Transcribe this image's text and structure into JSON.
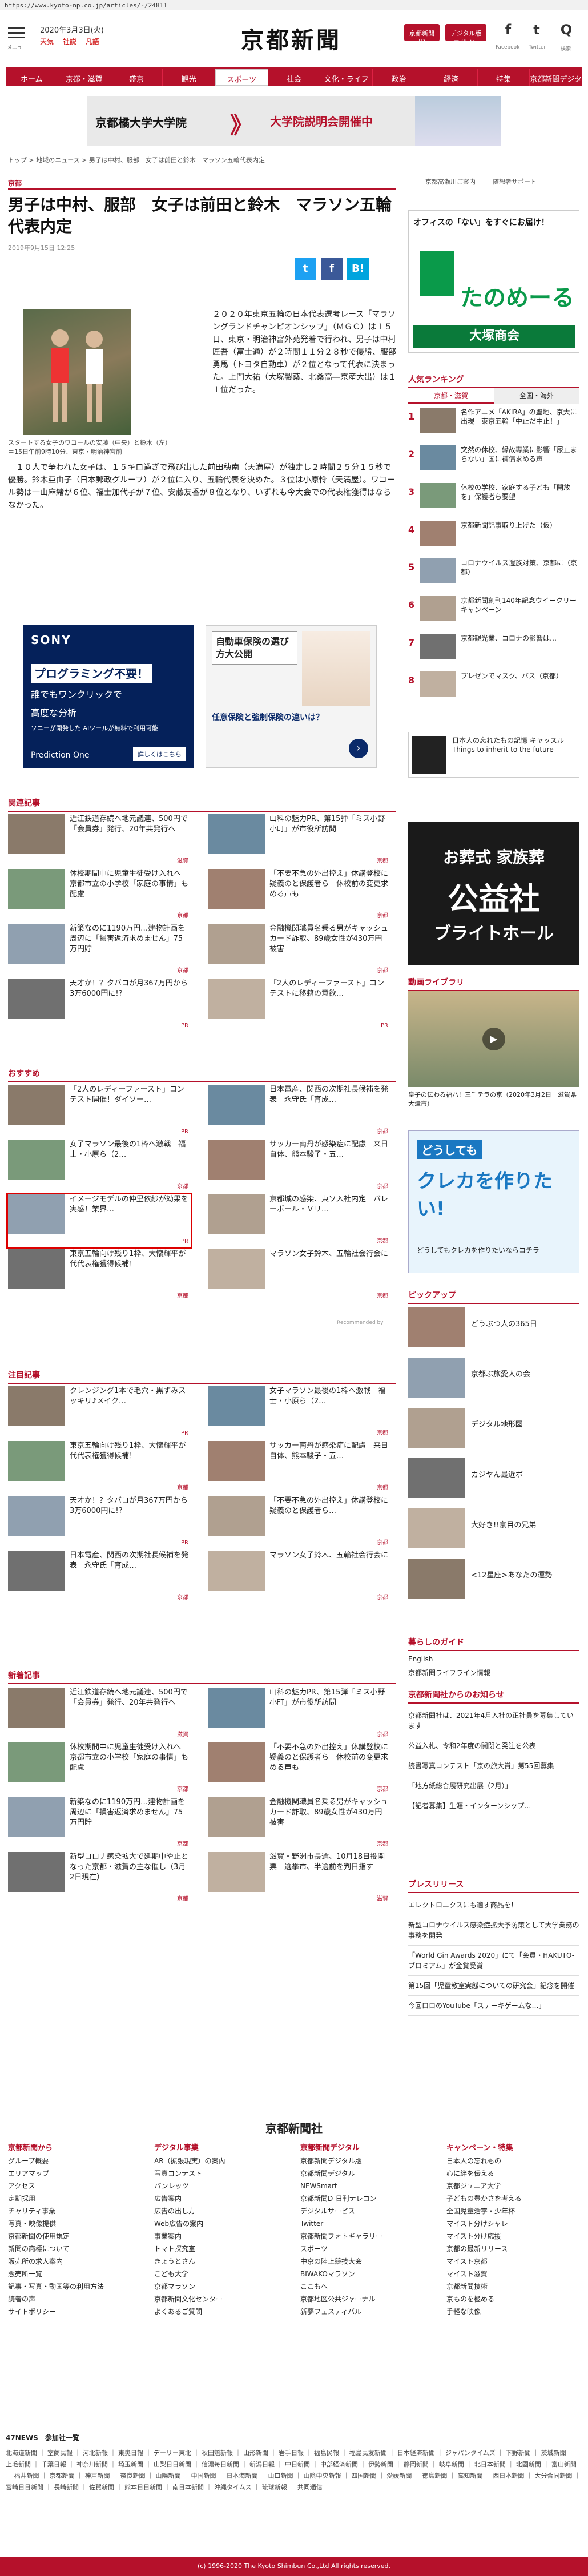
{
  "url": "https://www.kyoto-np.co.jp/articles/-/24811",
  "header": {
    "menu_label": "メニュー",
    "logo": "京都新聞",
    "date": "2020年3月3日(火)",
    "weather": [
      "天気",
      "社説",
      "凡語"
    ],
    "btn_register": "京都新聞ID",
    "btn_digital": "デジタル版ログイン",
    "social": [
      "f",
      "t",
      "Q"
    ],
    "social_labels": [
      "Facebook",
      "Twitter",
      "検索"
    ]
  },
  "nav": [
    "ホーム",
    "京都・滋賀",
    "盛京",
    "観光",
    "スポーツ",
    "社会",
    "文化・ライフ",
    "政治",
    "経済",
    "特集",
    "京都新聞デジタル"
  ],
  "nav_active": 4,
  "banner_top": {
    "text1": "京都橘大学大学院",
    "text2": "》",
    "text3": "大学院説明会開催中"
  },
  "breadcrumb": "トップ > 地域のニュース > 男子は中村、服部　女子は前田と鈴木　マラソン五輪代表内定",
  "breadcrumb_right": [
    "京都高瀬川ご案内",
    "随想者サポート"
  ],
  "article": {
    "section": "京都",
    "title": "男子は中村、服部　女子は前田と鈴木　マラソン五輪代表内定",
    "published": "2019年9月15日 12:25",
    "photo_caption": "スタートする女子のワコールの安藤（中央）と鈴木（左）＝15日午前9時10分、東京・明治神宮前",
    "p1": "２０２０年東京五輪の日本代表選考レース「マラソングランドチャンピオンシップ」（ＭＧＣ）は１５日、東京・明治神宮外苑発着で行われ、男子は中村匠吾（富士通）が２時間１１分２８秒で優勝、服部勇馬（トヨタ自動車）が２位となって代表に決まった。上門大祐（大塚製薬、北桑高―京産大出）は１１位だった。",
    "p2": "１０人で争われた女子は、１５キロ過ぎで飛び出した前田穂南（天満屋）が独走し２時間２５分１５秒で優勝。鈴木亜由子（日本郵政グループ）が２位に入り、五輪代表を決めた。３位は小原怜（天満屋）。ワコール勢は一山麻緒が６位、福士加代子が７位、安藤友香が８位となり、いずれも今大会での代表権獲得はならなかった。"
  },
  "ads_article": {
    "sony_brand": "SONY",
    "sony_line1": "プログラミング不要！",
    "sony_line2": "誰でもワンクリックで",
    "sony_line3": "高度な分析",
    "sony_line4": "ソニーが開発した AIツールが無料で利用可能",
    "sony_bottom": "Prediction One",
    "sony_cta": "詳しくはこちら",
    "ins_title": "自動車保険の選び方大公開",
    "ins_text": "任意保険と強制保険の違いは？"
  },
  "related": {
    "title": "関連記事",
    "items": [
      {
        "text": "近江鉄道存続へ地元議連、500円で「会員券」発行、20年共発行へ",
        "tag": "滋賀"
      },
      {
        "text": "山科の魅力PR、第15弾「ミス小野小町」が市役所訪問",
        "tag": "京都"
      },
      {
        "text": "休校期間中に児童生徒受け入れへ　京都市立の小学校「家庭の事情」も配慮",
        "tag": "京都"
      },
      {
        "text": "「不要不急の外出控え」休講登校に疑義のと保護者ら　休校前の変更求める声も",
        "tag": "京都"
      },
      {
        "text": "新築なのに1190万円…建物計画を周辺に「損害返済求めません」75万円貯",
        "tag": "京都"
      },
      {
        "text": "金融機関職員名乗る男がキャッシュカード詐取、89歳女性が430万円被害",
        "tag": "京都"
      },
      {
        "text": "天才か！？タバコが月367万円から3万6000円に!?",
        "tag": "PR"
      },
      {
        "text": "「2人のレディーファースト」コンテストに移籍の意欲…",
        "tag": "PR"
      }
    ]
  },
  "recommend": {
    "title": "おすすめ",
    "items": [
      {
        "text": "「2人のレディーファースト」コンテスト開催！ダイソー…",
        "tag": "PR"
      },
      {
        "text": "日本電産、関西の次期社長候補を発表　永守氏「育成…",
        "tag": "京都"
      },
      {
        "text": "女子マラソン最後の1枠へ激戦　福士・小原ら（2…",
        "tag": "京都"
      },
      {
        "text": "サッカー南丹が感染症に配慮　来日自体、熊本駿子・五…",
        "tag": "京都"
      },
      {
        "text": "イメージモデルの仲里依紗が効果を実感！業界…",
        "tag": "PR"
      },
      {
        "text": "京都城の感染、東ソ入社内定　バレーボール・Ｖリ…",
        "tag": "京都"
      },
      {
        "text": "東京五輪向け残り1枠、大懐輝平が代代表権獲得候補！",
        "tag": "京都"
      },
      {
        "text": "マラソン女子鈴木、五輪社会行会に",
        "tag": "京都"
      }
    ],
    "powered": "Recommended by"
  },
  "attention": {
    "title": "注目記事",
    "items": [
      {
        "text": "クレンジング1本で毛穴・黒ずみスッキリ♪メイク…",
        "tag": "PR"
      },
      {
        "text": "女子マラソン最後の1枠へ激戦　福士・小原ら（2…",
        "tag": "京都"
      },
      {
        "text": "東京五輪向け残り1枠、大懐輝平が代代表権獲得候補！",
        "tag": "京都"
      },
      {
        "text": "サッカー南丹が感染症に配慮　来日自体、熊本駿子・五…",
        "tag": "京都"
      },
      {
        "text": "天才か！？タバコが月367万円から3万6000円に!?",
        "tag": "PR"
      },
      {
        "text": "「不要不急の外出控え」休講登校に疑義のと保護者ら…",
        "tag": "京都"
      },
      {
        "text": "日本電産、関西の次期社長候補を発表　永守氏「育成…",
        "tag": "京都"
      },
      {
        "text": "マラソン女子鈴木、五輪社会行会に",
        "tag": "京都"
      }
    ]
  },
  "latest": {
    "title": "新着記事",
    "items": [
      {
        "text": "近江鉄道存続へ地元議連、500円で「会員券」発行、20年共発行へ",
        "tag": "滋賀"
      },
      {
        "text": "山科の魅力PR、第15弾「ミス小野小町」が市役所訪問",
        "tag": "京都"
      },
      {
        "text": "休校期間中に児童生徒受け入れへ　京都市立の小学校「家庭の事情」も配慮",
        "tag": "京都"
      },
      {
        "text": "「不要不急の外出控え」休講登校に疑義のと保護者ら　休校前の変更求める声も",
        "tag": "京都"
      },
      {
        "text": "新築なのに1190万円…建物計画を周辺に「損害返済求めません」75万円貯",
        "tag": "京都"
      },
      {
        "text": "金融機関職員名乗る男がキャッシュカード詐取、89歳女性が430万円被害",
        "tag": "京都"
      },
      {
        "text": "新型コロナ感染拡大で延期中や止となった京都・滋賀の主な催し（3月2日現在）",
        "tag": "京都"
      },
      {
        "text": "滋賀・野洲市長選、10月18日投開票　選挙市、半選前を判日指す",
        "tag": "滋賀"
      }
    ]
  },
  "sidebar": {
    "ad_tanomail": "オフィスの「ない」をすぐにお届け！",
    "ad_tanomail_brand": "たのめーる",
    "ad_tanomail_corp": "大塚商会",
    "ranking_title": "人気ランキング",
    "ranking_tabs": [
      "京都・滋賀",
      "全国・海外"
    ],
    "ranking": [
      "名作アニメ「AKIRA」の聖地、京大に出現　東京五輪「中止だ中止！」",
      "突然の休校、縁故専業に影響「尿止まらない」国に補償求める声",
      "休校の学校、家庭する子ども「開放を」保護者ら要望",
      "京都新聞記事取り上げた（仮）",
      "コロナウイルス遺族対策、京都に（京都）",
      "京都新聞創刊140年記念ウイークリーキャンペーン",
      "京都観光業、コロナの影響は…",
      "プレゼンでマスク、バス（京都）"
    ],
    "ad_hotel_title": "日本人の忘れたもの記憶 キャッスル Things to inherit to the future",
    "ad_funeral_1": "お葬式 家族葬",
    "ad_funeral_2": "公益社",
    "ad_funeral_3": "ブライトホール",
    "video_title": "動画ライブラリ",
    "video_caption": "皇子の伝わる福ハ！三千テラの京（2020年3月2日　滋賀県大津市）",
    "ad_credit_1": "どうしても",
    "ad_credit_2": "クレカを作りたい!",
    "ad_credit_3": "どうしてもクレカを作りたいならコチラ",
    "pickup_title": "ピックアップ",
    "pickup": [
      "どうぶつ人の365日",
      "京都ぶ旅愛人の会",
      "デジタル地形図",
      "カジヤん最近ボ",
      "大好き!!京目の兄弟",
      "<12星座>あなたの運勢"
    ],
    "guide_title": "暮らしのガイド",
    "guide": [
      "English",
      "京都新聞ライフライン情報"
    ],
    "notice_title": "京都新聞社からのお知らせ",
    "notices": [
      "京都新聞社は、2021年4月入社の正社員を募集しています",
      "公益入札、令和2年度の開閉と発注を公表",
      "読書写真コンテスト「京の旅大賞」第55回募集",
      "「地方紙総合展研究出展（2月）」",
      "【記者募集】生涯・インターンシップ…"
    ],
    "press_title": "プレスリリース",
    "press": [
      "エレクトロニクスにも適す商品を！",
      "新型コロナウイルス感染症拡大予防策として大学業務の事務を開発",
      "「World Gin Awards 2020」にて「会員・HAKUTO-ブロミアム」が金賞受賞",
      "第15回「児童教室実態についての研究会」記念を開催",
      "今回ロロのYouTube「ステーキゲームな…」"
    ]
  },
  "footer": {
    "logo": "京都新聞社",
    "cols": [
      {
        "h": "京都新聞から",
        "items": [
          "グループ概要",
          "エリアマップ",
          "アクセス",
          "定期採用",
          "チャリティ事業",
          "写真・映像提供",
          "京都新聞の使用規定",
          "新聞の商標について",
          "販売所の求人案内",
          "販売所一覧",
          "記事・写真・動画等の利用方法",
          "読者の声",
          "サイトポリシー"
        ]
      },
      {
        "h": "デジタル事業",
        "items": [
          "AR（拡張現実）の案内",
          "写真コンテスト",
          "パンレッツ",
          "広告案内",
          "広告の出し方",
          "Web広告の案内",
          "事業案内",
          "トマト探究室",
          "きょうとさん",
          "こども大学",
          "京都マラソン",
          "京都新聞文化センター",
          "よくあるご質問"
        ]
      },
      {
        "h": "京都新聞デジタル",
        "items": [
          "京都新聞デジタル版",
          "京都新聞デジタル",
          "NEWSmart",
          "京都新聞D-日刊テレコン",
          "デジタルサービス",
          "Twitter",
          "京都新聞フォトギャラリー",
          "スポーツ",
          "中京の陸上競技大会",
          "BIWAKOマラソン",
          "ここもへ",
          "京都地区公共ジャーナル",
          "新夢フェスティバル"
        ]
      },
      {
        "h": "キャンペーン・特集",
        "items": [
          "日本人の忘れもの",
          "心に絆を伝える",
          "京都ジュニア大学",
          "子どもの豊かさを考える",
          "全国児童活字・少年杯",
          "マイスト分けシャレ",
          "マイスト分け応援",
          "京都の最新リリース",
          "マイスト京都",
          "マイスト滋賀",
          "京都新聞技術",
          "京ものを極める",
          "手軽な映像"
        ]
      }
    ]
  },
  "news47": {
    "title": "47NEWS　参加社一覧",
    "text": "北海道新聞 ｜ 室蘭民報 ｜ 河北新報 ｜ 東奥日報 ｜ デーリー東北 ｜ 秋田魁新報 ｜ 山形新聞 ｜ 岩手日報 ｜ 福島民報 ｜ 福島民友新聞 ｜ 日本経済新聞 ｜ ジャパンタイムズ ｜ 下野新聞 ｜ 茨城新聞 ｜ 上毛新聞 ｜ 千葉日報 ｜ 神奈川新聞 ｜ 埼玉新聞 ｜ 山梨日日新聞 ｜ 信濃毎日新聞 ｜ 新潟日報 ｜ 中日新聞 ｜ 中部経済新聞 ｜ 伊勢新聞 ｜ 静岡新聞 ｜ 岐阜新聞 ｜ 北日本新聞 ｜ 北國新聞 ｜ 富山新聞 ｜ 福井新聞 ｜ 京都新聞 ｜ 神戸新聞 ｜ 奈良新聞 ｜ 山陽新聞 ｜ 中国新聞 ｜ 日本海新聞 ｜ 山口新聞 ｜ 山陰中央新報 ｜ 四国新聞 ｜ 愛媛新聞 ｜ 徳島新聞 ｜ 高知新聞 ｜ 西日本新聞 ｜ 大分合同新聞 ｜ 宮崎日日新聞 ｜ 長崎新聞 ｜ 佐賀新聞 ｜ 熊本日日新聞 ｜ 南日本新聞 ｜ 沖縄タイムス ｜ 琉球新報 ｜ 共同通信"
  },
  "copyright": "(c) 1996-2020 The Kyoto Shimbun Co.,Ltd All rights reserved."
}
